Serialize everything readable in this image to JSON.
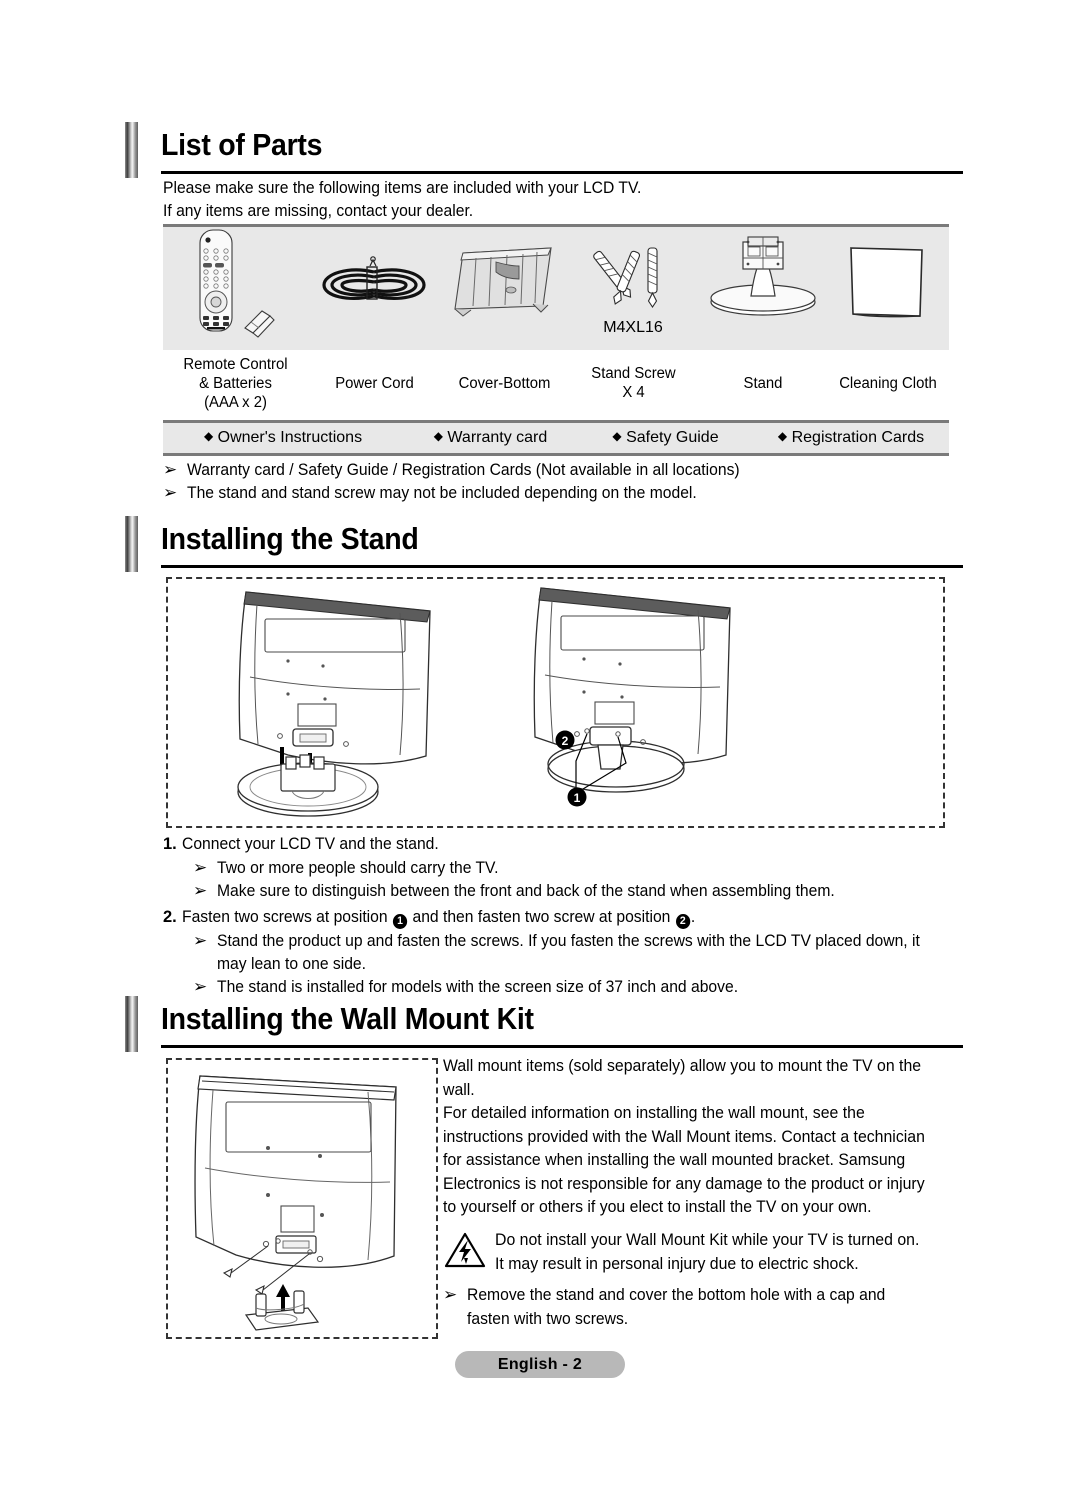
{
  "page": {
    "footer_label": "English - 2",
    "accent_gray": "#e8e8e8",
    "rule_gray": "#7a7a7a",
    "footer_bg": "#b8b8b8"
  },
  "sections": {
    "list_of_parts": {
      "title": "List of Parts",
      "intro_line1": "Please make sure the following items are included with your LCD TV.",
      "intro_line2": "If any items are missing, contact your dealer.",
      "parts": [
        {
          "icon": "remote-control-icon",
          "label_lines": [
            "Remote Control",
            "& Batteries",
            "(AAA x  2)"
          ],
          "caption": ""
        },
        {
          "icon": "power-cord-icon",
          "label_lines": [
            "Power Cord"
          ],
          "caption": ""
        },
        {
          "icon": "cover-bottom-icon",
          "label_lines": [
            "Cover-Bottom"
          ],
          "caption": ""
        },
        {
          "icon": "stand-screw-icon",
          "label_lines": [
            "Stand Screw",
            "X 4"
          ],
          "caption": "M4XL16"
        },
        {
          "icon": "stand-icon",
          "label_lines": [
            "Stand"
          ],
          "caption": ""
        },
        {
          "icon": "cleaning-cloth-icon",
          "label_lines": [
            "Cleaning Cloth"
          ],
          "caption": ""
        }
      ],
      "documents": [
        "Owner's Instructions",
        "Warranty card",
        "Safety Guide",
        "Registration Cards"
      ],
      "notes": [
        "Warranty card / Safety Guide / Registration Cards (Not available in all locations)",
        "The stand and stand screw may not be included depending on the model."
      ]
    },
    "installing_the_stand": {
      "title": "Installing the Stand",
      "diagram_markers": [
        "1",
        "2"
      ],
      "steps": [
        {
          "number": "1.",
          "text": "Connect your LCD TV and the stand.",
          "notes": [
            "Two or more people should carry the TV.",
            "Make sure to distinguish between the front and back of the stand when assembling them."
          ]
        },
        {
          "number": "2.",
          "text_before": "Fasten two screws at position ",
          "marker_1": "1",
          "text_middle": " and then fasten two screw at position ",
          "marker_2": "2",
          "text_after": ".",
          "notes": [
            "Stand the product up and fasten the screws. If you fasten the screws with the LCD TV placed down, it may lean to one side.",
            "The stand is installed for models with the screen size of 37 inch and above."
          ]
        }
      ]
    },
    "installing_the_wall_mount_kit": {
      "title": "Installing the Wall Mount Kit",
      "paragraphs": [
        "Wall mount items (sold separately) allow you to mount the TV on the wall.",
        "For detailed information on installing the wall mount, see the instructions provided with the Wall Mount items. Contact a technician for assistance when installing the wall mounted bracket. Samsung Electronics is not responsible for any damage to the product or injury to yourself or others if you elect to install the TV on your own."
      ],
      "warning": "Do not install your Wall Mount Kit while your TV is turned on. It may result in personal injury due to electric shock.",
      "note": "Remove the stand and cover the bottom hole with a cap and fasten with two screws."
    }
  }
}
